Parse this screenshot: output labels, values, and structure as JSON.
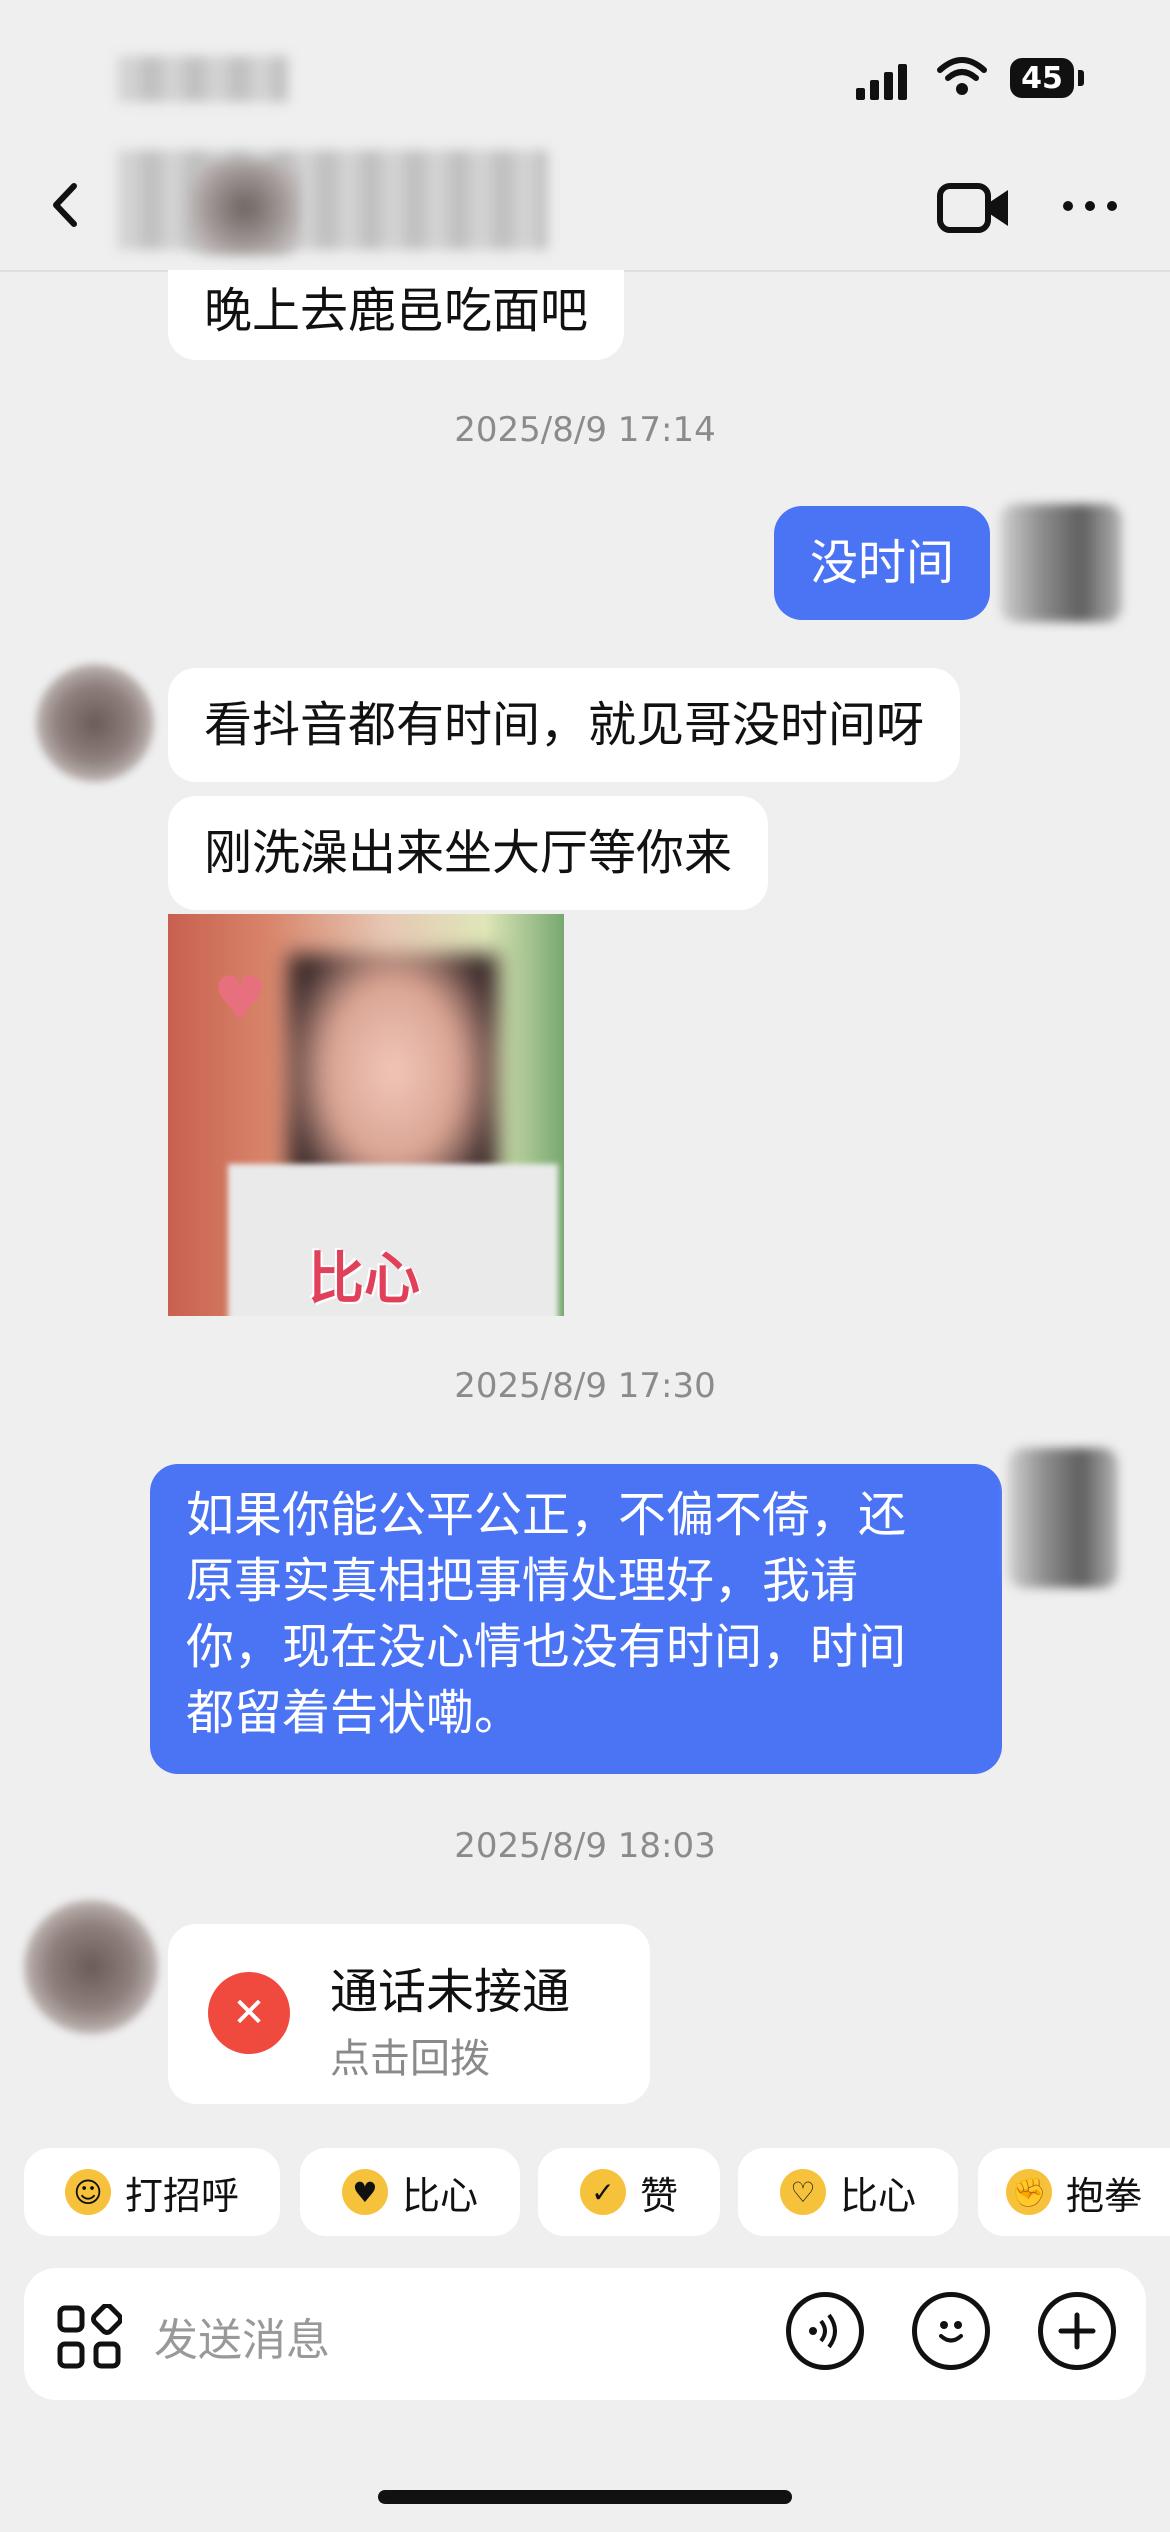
{
  "status_bar": {
    "battery": "45"
  },
  "messages": {
    "m1": "晚上去鹿邑吃面吧",
    "ts1": "2025/8/9 17:14",
    "m2": "没时间",
    "m3": "看抖音都有时间，就见哥没时间呀",
    "m4": "刚洗澡出来坐大厅等你来",
    "sticker_text": "比心",
    "ts2": "2025/8/9 17:30",
    "m5_lines": [
      "如果你能公平公正，不偏不倚，还",
      "原事实真相把事情处理好，我请",
      "你，现在没心情也没有时间，时间",
      "都留着告状嘞。"
    ],
    "ts3": "2025/8/9 18:03"
  },
  "call": {
    "title": "通话未接通",
    "subtitle": "点击回拨"
  },
  "quick_replies": [
    "打招呼",
    "比心",
    "赞",
    "比心",
    "抱拳"
  ],
  "input": {
    "placeholder": "发送消息"
  },
  "colors": {
    "sent_bubble": "#4b74f5",
    "missed_call": "#f04a3e",
    "background": "#efefef"
  }
}
